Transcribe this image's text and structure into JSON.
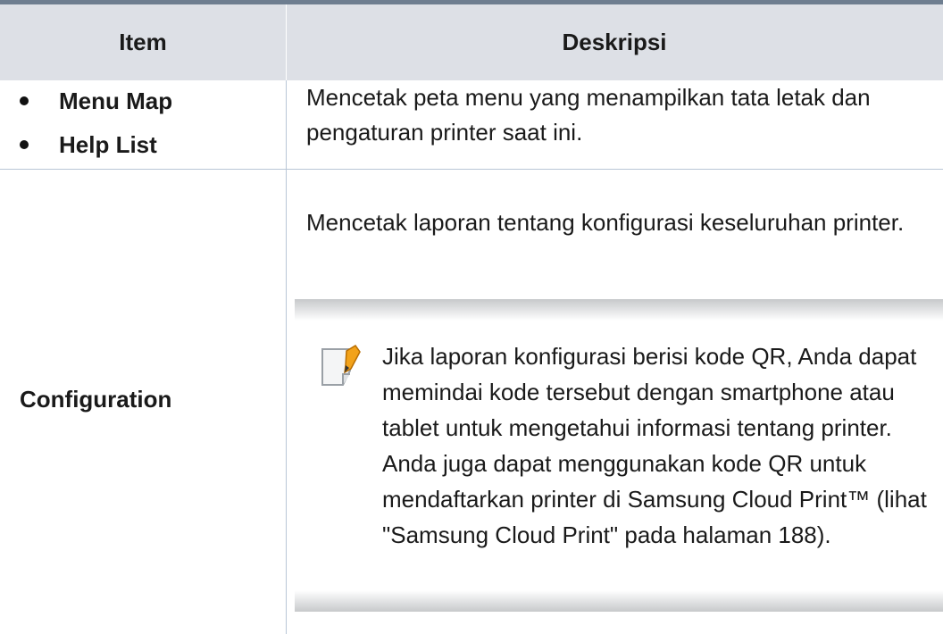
{
  "header": {
    "item": "Item",
    "description": "Deskripsi"
  },
  "rows": [
    {
      "items": [
        "Menu Map",
        "Help List"
      ],
      "description": "Mencetak peta menu yang menampilkan tata letak dan pengaturan printer saat ini."
    },
    {
      "item": "Configuration",
      "description": "Mencetak laporan tentang konfigurasi keseluruhan printer.",
      "note": {
        "icon": "note-pencil-icon",
        "text": "Jika laporan konfigurasi berisi kode QR, Anda dapat memindai kode tersebut dengan smartphone atau tablet untuk mengetahui informasi tentang printer. Anda juga dapat menggunakan kode QR untuk mendaftarkan printer di Samsung Cloud Print™ (lihat \"Samsung Cloud Print\" pada halaman 188)."
      }
    }
  ],
  "colors": {
    "header_bg": "#dde0e6",
    "header_top_border": "#6e7e90",
    "grid_line": "#b8c6d6"
  }
}
